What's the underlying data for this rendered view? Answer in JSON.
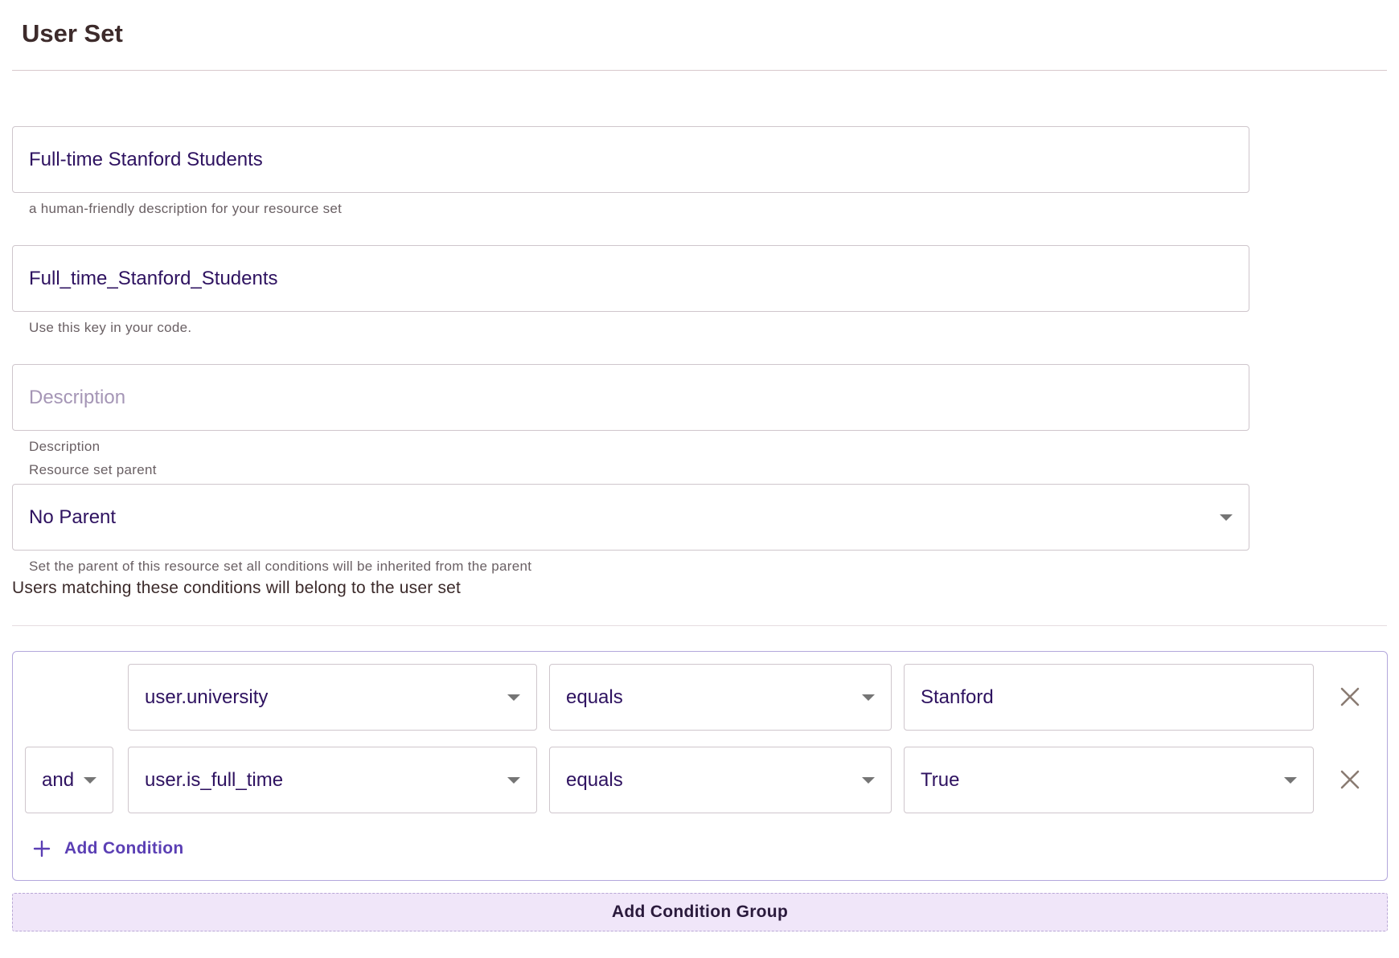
{
  "header": {
    "title": "User Set"
  },
  "form": {
    "name": {
      "value": "Full-time Stanford Students",
      "helper": "a human-friendly description for your resource set"
    },
    "key": {
      "value": "Full_time_Stanford_Students",
      "helper": "Use this key in your code."
    },
    "description": {
      "placeholder": "Description",
      "helper": "Description"
    },
    "parent": {
      "label": "Resource set parent",
      "value": "No Parent",
      "helper": "Set the parent of this resource set all conditions will be inherited from the parent"
    }
  },
  "conditions": {
    "section_label": "Users matching these conditions will belong to the user set",
    "rows": [
      {
        "attribute": "user.university",
        "operator": "equals",
        "value": "Stanford"
      },
      {
        "connector": "and",
        "attribute": "user.is_full_time",
        "operator": "equals",
        "value": "True"
      }
    ],
    "add_condition_label": "Add Condition",
    "add_group_label": "Add Condition Group"
  },
  "icons": {
    "close": "close-icon",
    "dropdown": "chevron-down-icon",
    "add": "plus-icon"
  },
  "colors": {
    "accent": "#5b3fb4",
    "input_text": "#2e1260",
    "group_border": "#b3a7dc",
    "add_group_bg": "#f0e6f9"
  }
}
